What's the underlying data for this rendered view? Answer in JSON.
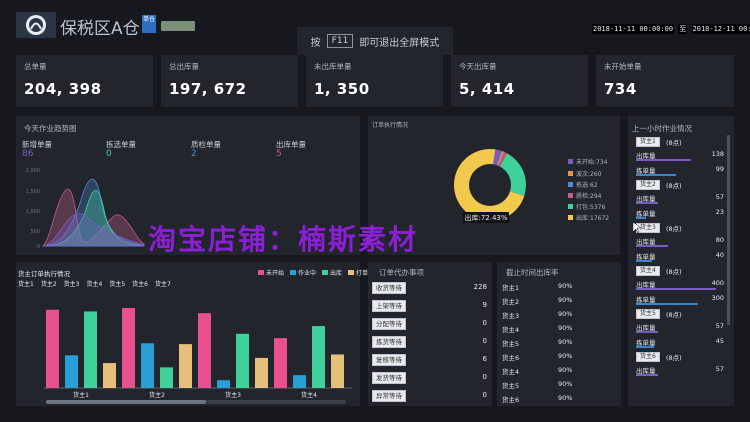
{
  "header": {
    "title": "保税区A仓",
    "badge": "单仓",
    "fullscreen_hint_prefix": "按",
    "fullscreen_key": "F11",
    "fullscreen_hint_suffix": "即可退出全屏模式",
    "date_start": "2018-11-11 00:00:00",
    "date_sep": "至",
    "date_end": "2018-12-11 00:00:00"
  },
  "stats": [
    {
      "label": "总单量",
      "value": "204, 398"
    },
    {
      "label": "总出库量",
      "value": "197, 672"
    },
    {
      "label": "未出库单量",
      "value": "1, 350"
    },
    {
      "label": "今天出库量",
      "value": "5, 414"
    },
    {
      "label": "未开始单量",
      "value": "734"
    }
  ],
  "trend": {
    "title": "今天作业趋势图",
    "kpis": [
      {
        "label": "新增单量",
        "value": "86",
        "color": "#7c5cc4"
      },
      {
        "label": "拣选单量",
        "value": "0",
        "color": "#3fd1a8"
      },
      {
        "label": "质检单量",
        "value": "2",
        "color": "#4e8ad6"
      },
      {
        "label": "出库单量",
        "value": "5",
        "color": "#c45c86"
      }
    ],
    "y_ticks": [
      "2,000",
      "1,500",
      "1,000",
      "500",
      "0"
    ]
  },
  "donut": {
    "title": "订单执行情况",
    "center_label": "出库:72.43%",
    "legend": [
      {
        "label": "未开始:734",
        "color": "#7a5cc4"
      },
      {
        "label": "波次:260",
        "color": "#e6944a"
      },
      {
        "label": "拣选:62",
        "color": "#4e8ad6"
      },
      {
        "label": "质检:294",
        "color": "#c45c86"
      },
      {
        "label": "打包:5376",
        "color": "#3fd19a"
      },
      {
        "label": "出库:17672",
        "color": "#f2c94c"
      }
    ],
    "chart_data": {
      "type": "pie",
      "categories": [
        "未开始",
        "波次",
        "拣选",
        "质检",
        "打包",
        "出库"
      ],
      "values": [
        734,
        260,
        62,
        294,
        5376,
        17672
      ]
    }
  },
  "owner_chart": {
    "title": "货主订单执行情况",
    "owners_row": [
      "货主1",
      "货主2",
      "货主3",
      "货主4",
      "货主5",
      "货主6",
      "货主7"
    ],
    "legend": [
      {
        "label": "未开始",
        "color": "#e9508f"
      },
      {
        "label": "作业中",
        "color": "#2a9fd6"
      },
      {
        "label": "出库",
        "color": "#3fd19a"
      },
      {
        "label": "打单",
        "color": "#e6c07a"
      }
    ],
    "chart_data": {
      "type": "bar",
      "categories": [
        "货主1",
        "货主2",
        "货主3",
        "货主4"
      ],
      "ylim": [
        0,
        100
      ],
      "series": [
        {
          "name": "未开始",
          "color": "#e9508f",
          "values": [
            91,
            93,
            87,
            58
          ]
        },
        {
          "name": "作业中",
          "color": "#2a9fd6",
          "values": [
            38,
            52,
            9,
            15
          ]
        },
        {
          "name": "出库",
          "color": "#3fd19a",
          "values": [
            89,
            24,
            63,
            72
          ]
        },
        {
          "name": "打单",
          "color": "#e6c07a",
          "values": [
            29,
            51,
            35,
            39
          ]
        }
      ]
    }
  },
  "todo": {
    "title": "订单代办事项",
    "items": [
      {
        "label": "收货等待",
        "value": "228"
      },
      {
        "label": "上架等待",
        "value": "9"
      },
      {
        "label": "分配等待",
        "value": "0"
      },
      {
        "label": "拣货等待",
        "value": "0"
      },
      {
        "label": "复核等待",
        "value": "6"
      },
      {
        "label": "发货等待",
        "value": "0"
      },
      {
        "label": "异常等待",
        "value": "0"
      }
    ]
  },
  "rate": {
    "title": "截止时间出库率",
    "rows": [
      {
        "owner": "货主1",
        "value": "90%"
      },
      {
        "owner": "货主2",
        "value": "90%"
      },
      {
        "owner": "货主3",
        "value": "90%"
      },
      {
        "owner": "货主4",
        "value": "90%"
      },
      {
        "owner": "货主5",
        "value": "90%"
      },
      {
        "owner": "货主6",
        "value": "90%"
      },
      {
        "owner": "货主4",
        "value": "90%"
      },
      {
        "owner": "货主5",
        "value": "90%"
      },
      {
        "owner": "货主6",
        "value": "90%"
      }
    ]
  },
  "hourly": {
    "title": "上一小时作业情况",
    "groups": [
      {
        "owner": "货主1",
        "suffix": "(8点)",
        "out_label": "出库量",
        "out_value": "138",
        "out_level": 0.69,
        "pick_label": "拣单量",
        "pick_value": "99",
        "pick_level": 0.5
      },
      {
        "owner": "货主2",
        "suffix": "(8点)",
        "out_label": "出库量",
        "out_value": "57",
        "out_level": 0.28,
        "pick_label": "拣单量",
        "pick_value": "23",
        "pick_level": 0.12
      },
      {
        "owner": "货主3",
        "suffix": "(8点)",
        "out_label": "出库量",
        "out_value": "80",
        "out_level": 0.4,
        "pick_label": "拣单量",
        "pick_value": "40",
        "pick_level": 0.2
      },
      {
        "owner": "货主4",
        "suffix": "(8点)",
        "out_label": "出库量",
        "out_value": "400",
        "out_level": 1.0,
        "pick_label": "拣单量",
        "pick_value": "300",
        "pick_level": 0.78
      },
      {
        "owner": "货主5",
        "suffix": "(8点)",
        "out_label": "出库量",
        "out_value": "57",
        "out_level": 0.28,
        "pick_label": "拣单量",
        "pick_value": "45",
        "pick_level": 0.22
      },
      {
        "owner": "货主6",
        "suffix": "(8点)",
        "out_label": "出库量",
        "out_value": "57",
        "out_level": 0.28
      }
    ]
  },
  "watermark": "淘宝店铺：楠斯素材",
  "colors": {
    "background": "#16181d",
    "panel": "#22252c",
    "accent_purple": "#7a5cc4",
    "accent_blue": "#3a86d6"
  }
}
